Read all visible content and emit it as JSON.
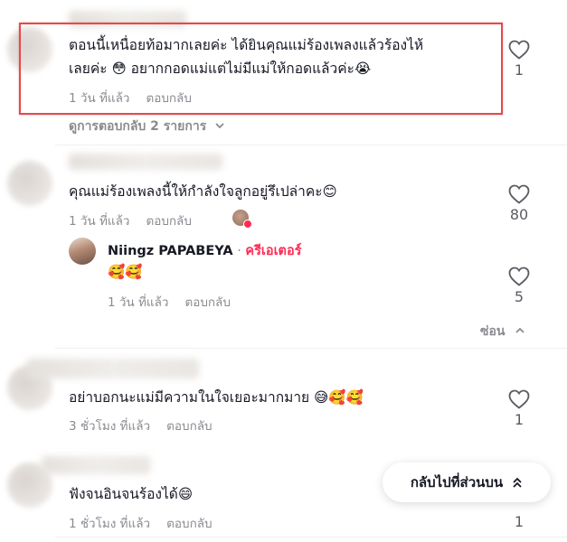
{
  "comments": [
    {
      "text_line1": "ตอนนี้เหนื่อยท้อมากเลยค่ะ ได้ยินคุณแม่ร้องเพลงแล้วร้องไห้",
      "text_line2": "เลยค่ะ 😳 อยากกอดแม่แต่ไม่มีแม่ให้กอดแล้วค่ะ😭",
      "time": "1 วัน ที่แล้ว",
      "reply": "ตอบกลับ",
      "likes": "1",
      "view_replies": "ดูการตอบกลับ 2 รายการ"
    },
    {
      "text": "คุณแม่ร้องเพลงนี้ให้กำลังใจลูกอยู่รึเปล่าคะ😊",
      "time": "1 วัน ที่แล้ว",
      "reply": "ตอบกลับ",
      "likes": "80"
    },
    {
      "text": "อย่าบอกนะแม่มีความในใจเยอะมากมาย 😅🥰🥰",
      "time": "3 ชั่วโมง ที่แล้ว",
      "reply": "ตอบกลับ",
      "likes": "1"
    },
    {
      "text": "ฟังจนอินจนร้องได้😄",
      "time": "1 ชั่วโมง ที่แล้ว",
      "reply": "ตอบกลับ",
      "likes": "1"
    }
  ],
  "creator_reply": {
    "username": "Niingz  PAPABEYA",
    "separator": "·",
    "badge": "ครีเอเตอร์",
    "text": "🥰🥰",
    "time": "1 วัน ที่แล้ว",
    "reply": "ตอบกลับ",
    "likes": "5",
    "hide": "ซ่อน"
  },
  "back_to_top": "กลับไปที่ส่วนบน",
  "colors": {
    "highlight": "#e34b4b",
    "creator": "#fe2c55",
    "muted": "#8a8b91"
  },
  "icons": [
    "heart-icon",
    "chevron-down-icon",
    "chevron-up-icon",
    "double-chevron-up-icon",
    "liked-by-creator-avatar"
  ]
}
